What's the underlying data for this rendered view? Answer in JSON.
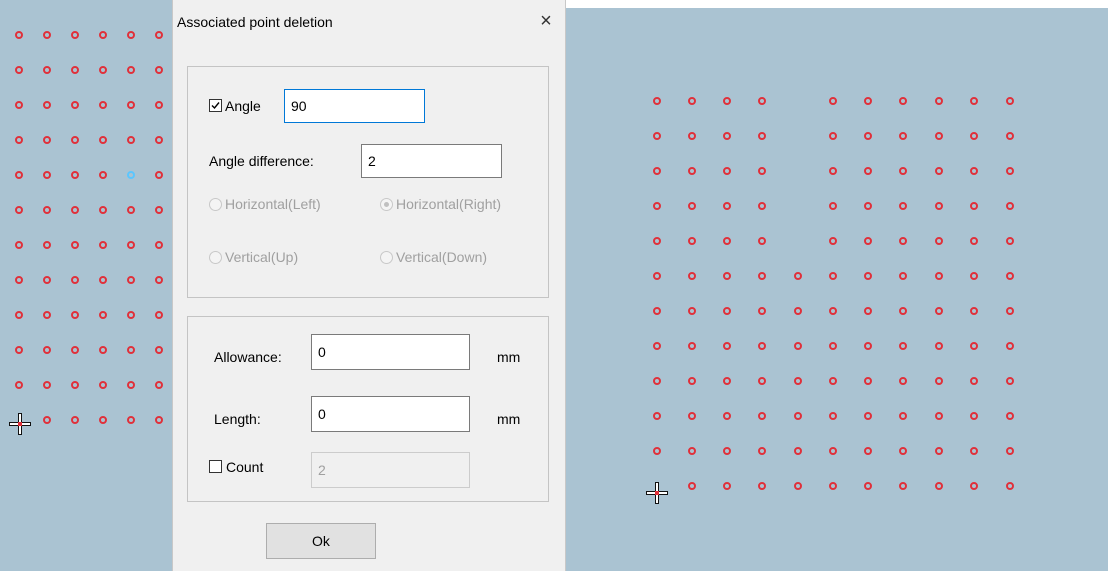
{
  "dialog": {
    "title": "Associated point deletion",
    "close_glyph": "×",
    "angle": {
      "checked": true,
      "label": "Angle",
      "value": "90"
    },
    "angle_difference": {
      "label": "Angle difference:",
      "value": "2"
    },
    "direction_options": [
      {
        "label": "Horizontal(Left)",
        "selected": false,
        "enabled": false
      },
      {
        "label": "Horizontal(Right)",
        "selected": true,
        "enabled": false
      },
      {
        "label": "Vertical(Up)",
        "selected": false,
        "enabled": false
      },
      {
        "label": "Vertical(Down)",
        "selected": false,
        "enabled": false
      }
    ],
    "allowance": {
      "label": "Allowance:",
      "value": "0",
      "unit": "mm"
    },
    "length": {
      "label": "Length:",
      "value": "0",
      "unit": "mm"
    },
    "count": {
      "checked": false,
      "label": "Count",
      "value": "2"
    },
    "ok_label": "Ok"
  },
  "colors": {
    "canvas_background": "#aac3d2",
    "point_color": "#e0303a",
    "highlight_point_color": "#5bc6ff",
    "dialog_background": "#f0f0f0"
  },
  "icons": [
    "point-marker-icon",
    "crosshair-cursor-icon",
    "checkbox-checked-icon",
    "radio-icon",
    "close-icon"
  ]
}
